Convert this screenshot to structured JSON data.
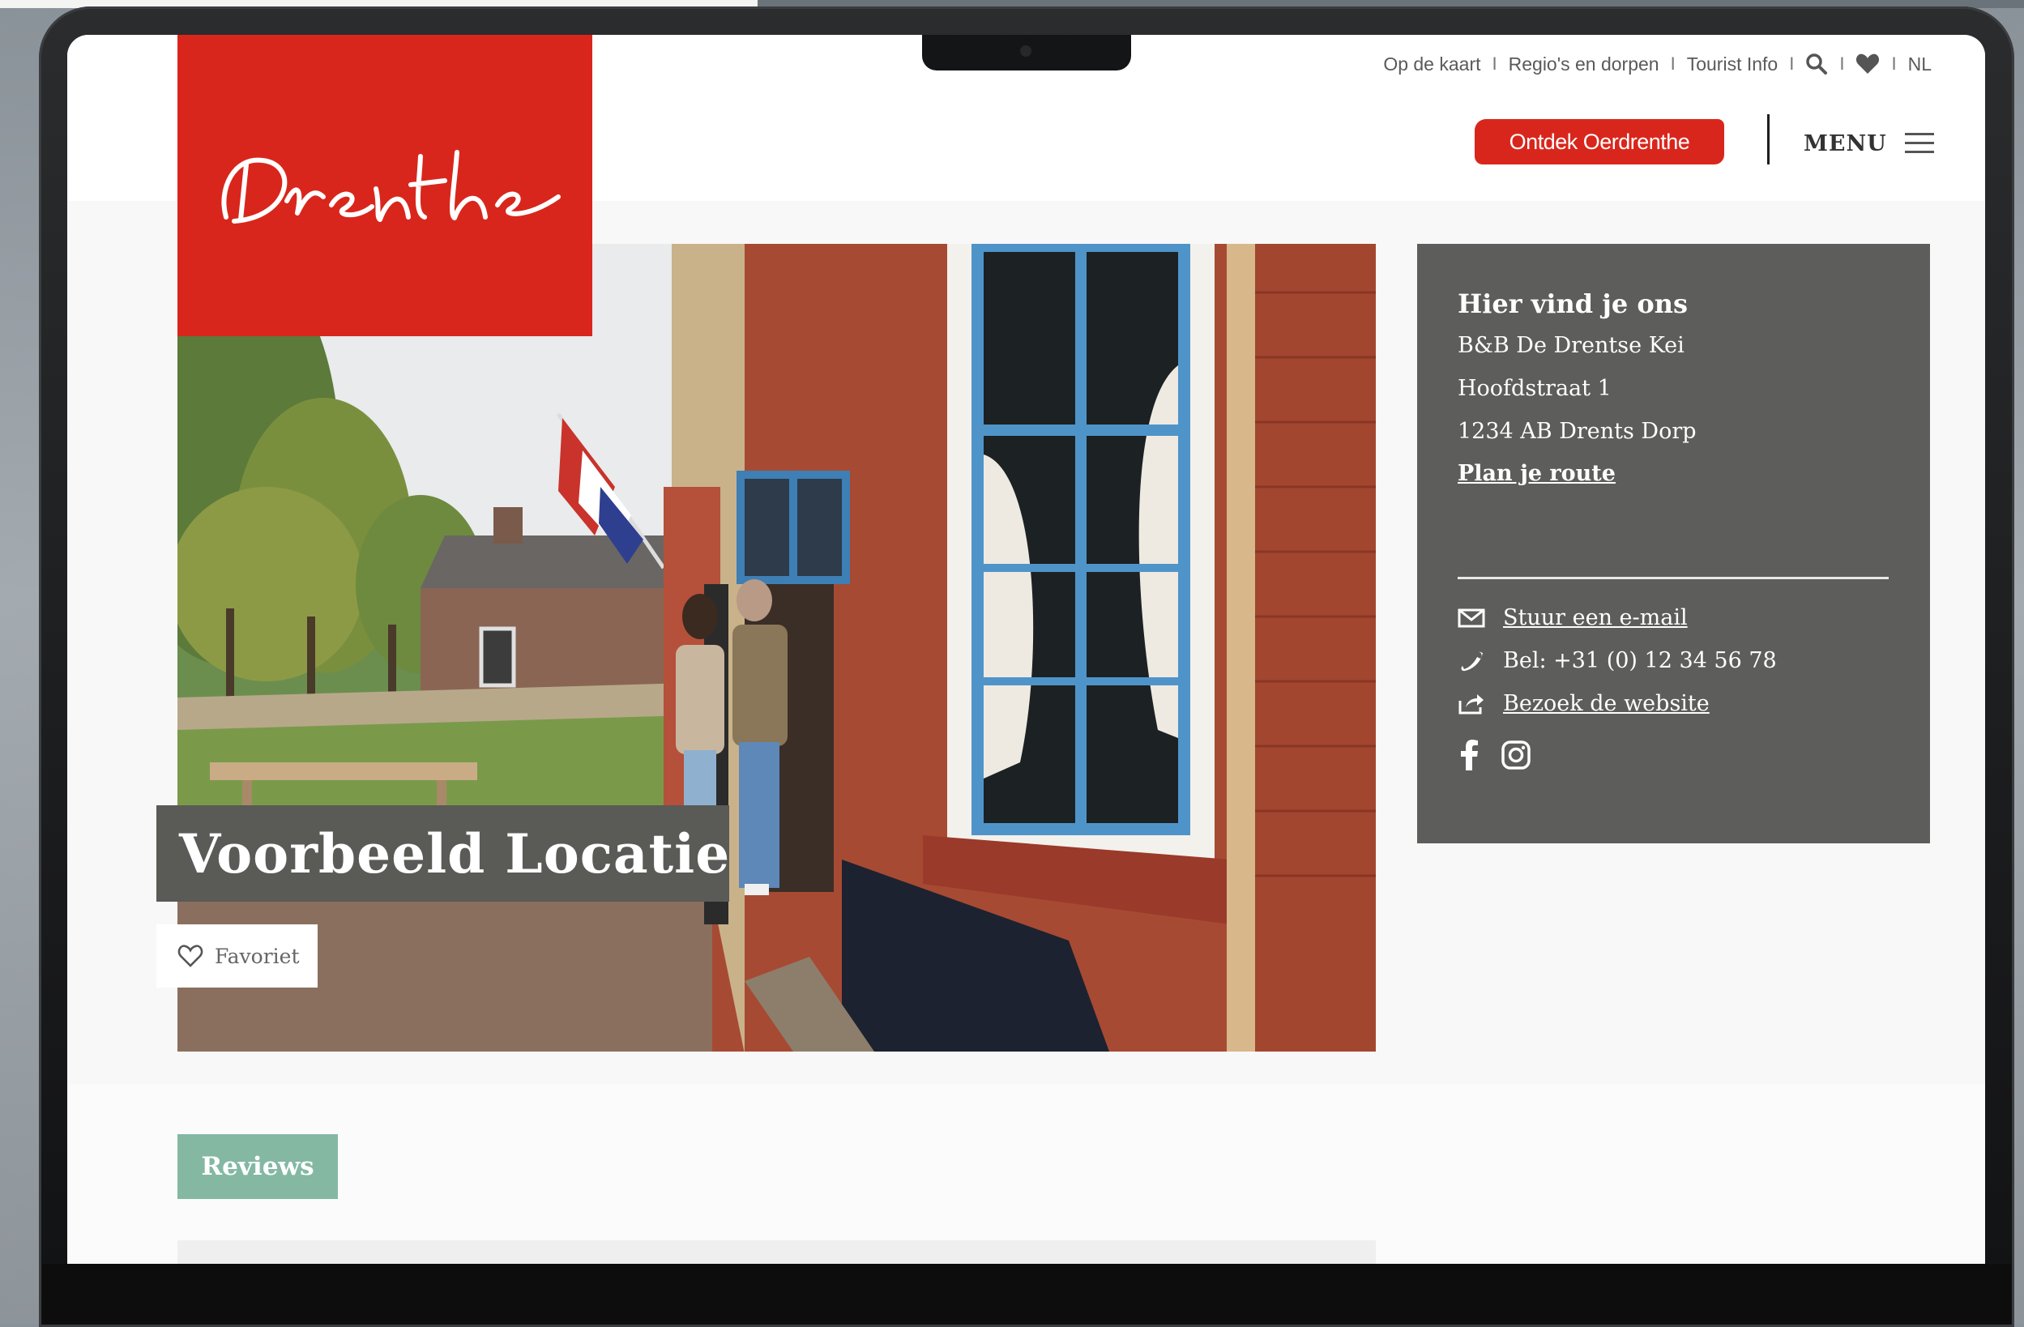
{
  "brand": {
    "logo_text": "Drenthe",
    "accent": "#d9261c"
  },
  "topnav": {
    "links": [
      "Op de kaart",
      "Regio's en dorpen",
      "Tourist Info"
    ],
    "search_icon": "search-icon",
    "heart_icon": "heart-icon",
    "language": "NL"
  },
  "header": {
    "cta_label": "Ontdek Oerdrenthe",
    "menu_label": "MENU",
    "menu_icon": "hamburger-icon"
  },
  "hero": {
    "title": "Voorbeeld Locatie",
    "favorite_label": "Favoriet"
  },
  "info": {
    "heading": "Hier vind je ons",
    "name": "B&B De Drentse Kei",
    "street": "Hoofdstraat 1",
    "city": "1234 AB Drents Dorp",
    "route_link": "Plan je route",
    "email_link": "Stuur een e-mail",
    "phone": "Bel: +31 (0) 12 34 56 78",
    "website_link": "Bezoek de website",
    "social_icons": [
      "facebook-icon",
      "instagram-icon"
    ]
  },
  "tabs": {
    "reviews_label": "Reviews",
    "reviews_color": "#84b8a3"
  }
}
